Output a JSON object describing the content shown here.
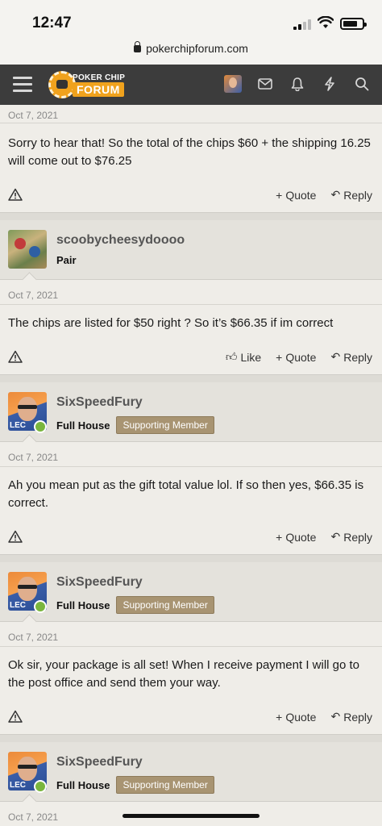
{
  "status": {
    "time": "12:47"
  },
  "browser": {
    "url": "pokerchipforum.com"
  },
  "forum": {
    "logo_top": "POKER CHIP",
    "logo_bottom": "FORUM"
  },
  "actions_labels": {
    "like": "Like",
    "quote": "Quote",
    "reply": "Reply"
  },
  "posts": [
    {
      "date": "Oct 7, 2021",
      "body": "Sorry to hear that! So the total of the chips $60 + the shipping 16.25 will come out to $76.25"
    },
    {
      "username": "scoobycheesydoooo",
      "title": "Pair",
      "date": "Oct 7, 2021",
      "body": "The chips are listed for $50 right ? So it’s $66.35 if im correct"
    },
    {
      "username": "SixSpeedFury",
      "title": "Full House",
      "badge": "Supporting Member",
      "date": "Oct 7, 2021",
      "body": "Ah you mean put as the gift total value lol. If so then yes, $66.35 is correct."
    },
    {
      "username": "SixSpeedFury",
      "title": "Full House",
      "badge": "Supporting Member",
      "date": "Oct 7, 2021",
      "body": "Ok sir, your package is all set! When I receive payment I will go to the post office and send them your way."
    },
    {
      "username": "SixSpeedFury",
      "title": "Full House",
      "badge": "Supporting Member",
      "date": "Oct 7, 2021"
    }
  ]
}
